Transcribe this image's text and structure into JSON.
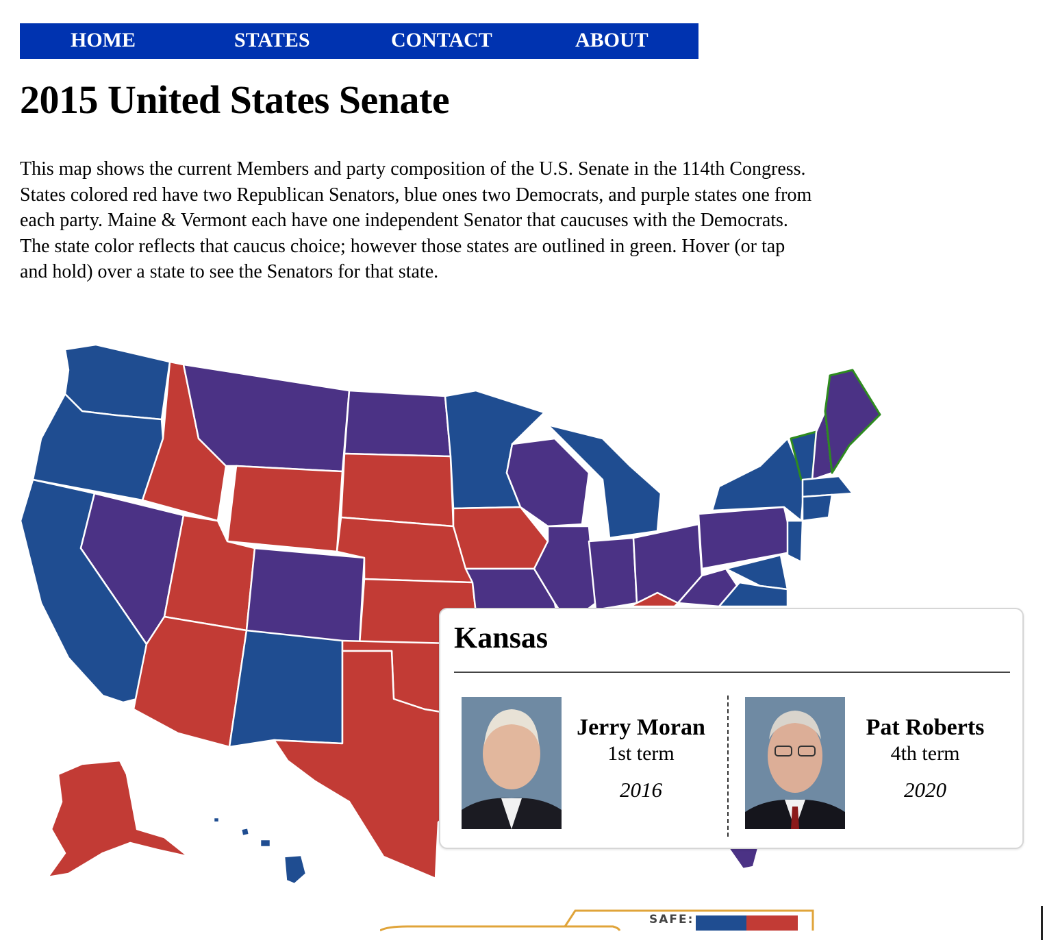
{
  "nav": {
    "items": [
      "HOME",
      "STATES",
      "CONTACT",
      "ABOUT"
    ]
  },
  "page": {
    "title": "2015 United States Senate",
    "intro": "This map shows the current Members and party composition of the U.S. Senate in the 114th Congress. States colored red have two Republican Senators, blue ones two Democrats, and purple states one from each party. Maine & Vermont each have one independent Senator that caucuses with the Democrats. The state color reflects that caucus choice; however those states are outlined in green. Hover (or tap and hold) over a state to see the Senators for that state."
  },
  "colors": {
    "nav_bg": "#0033b0",
    "democrat": "#1f4d91",
    "republican": "#c23b35",
    "split": "#4b3285",
    "independent_outline": "#2e8b1f"
  },
  "popup": {
    "state": "Kansas",
    "senators": [
      {
        "name": "Jerry Moran",
        "term": "1st term",
        "year": "2016",
        "photo": "senator-portrait"
      },
      {
        "name": "Pat Roberts",
        "term": "4th term",
        "year": "2020",
        "photo": "senator-portrait"
      }
    ]
  },
  "legend": {
    "safe_label": "SAFE:"
  }
}
